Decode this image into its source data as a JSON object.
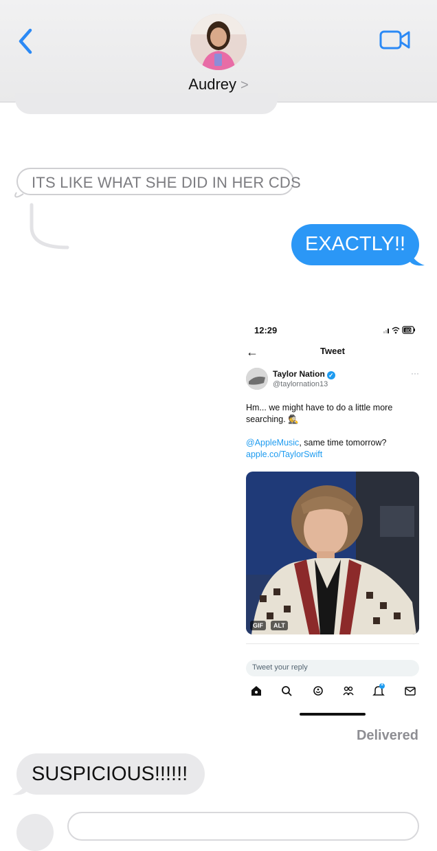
{
  "header": {
    "contact_name": "Audrey",
    "chevron": ">",
    "accent": "#2b89f5"
  },
  "thread": {
    "outline_reply_text": "ITS LIKE WHAT SHE DID IN HER CDS",
    "sent_text": "EXACTLY!!",
    "delivered_label": "Delivered",
    "received_text": "SUSPICIOUS!!!!!!"
  },
  "screenshot": {
    "time": "12:29",
    "battery": "80",
    "title": "Tweet",
    "author_name": "Taylor Nation",
    "author_handle": "@taylornation13",
    "body_line1": "Hm... we might have to do a little more",
    "body_line2_text": "searching.",
    "body_line2_emoji": "🕵",
    "body_mention": "@AppleMusic",
    "body_line3_rest": ", same time tomorrow?",
    "body_link": "apple.co/TaylorSwift",
    "media_badges": [
      "GIF",
      "ALT"
    ],
    "reply_placeholder": "Tweet your reply",
    "notification_count": "1",
    "colors": {
      "twitter_blue": "#1d9bf0"
    }
  },
  "colors": {
    "sent_bubble": "#2b97f6",
    "received_bubble": "#e9e9eb"
  }
}
